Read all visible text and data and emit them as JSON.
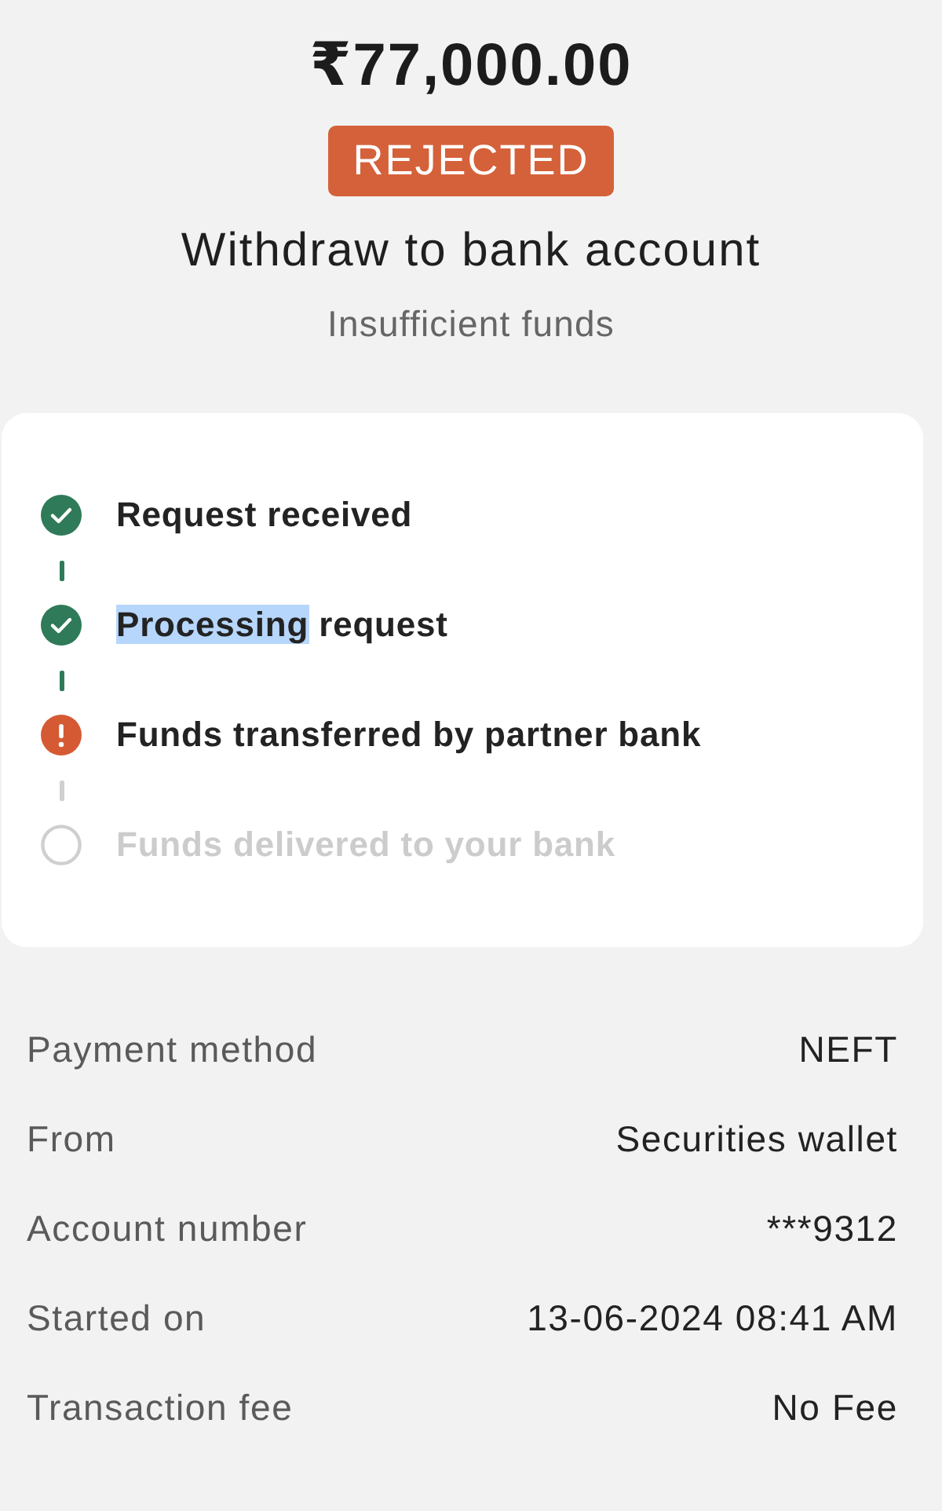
{
  "amount": "₹77,000.00",
  "status_badge": {
    "text": "REJECTED",
    "kind": "rejected"
  },
  "title": "Withdraw to bank account",
  "subtitle": "Insufficient funds",
  "steps": [
    {
      "kind": "done",
      "parts": [
        {
          "text": "Request received",
          "highlighted": false
        }
      ]
    },
    {
      "kind": "done",
      "parts": [
        {
          "text": "Processing",
          "highlighted": true
        },
        {
          "text": "request",
          "highlighted": false
        }
      ]
    },
    {
      "kind": "failed",
      "parts": [
        {
          "text": "Funds transferred by partner bank",
          "highlighted": false
        }
      ]
    },
    {
      "kind": "pending",
      "parts": [
        {
          "text": "Funds delivered to your bank",
          "highlighted": false
        }
      ]
    }
  ],
  "details": [
    {
      "label": "Payment method",
      "value": "NEFT"
    },
    {
      "label": "From",
      "value": "Securities wallet"
    },
    {
      "label": "Account number",
      "value": "***9312"
    },
    {
      "label": "Started on",
      "value": "13-06-2024 08:41 AM"
    },
    {
      "label": "Transaction fee",
      "value": "No Fee"
    }
  ]
}
